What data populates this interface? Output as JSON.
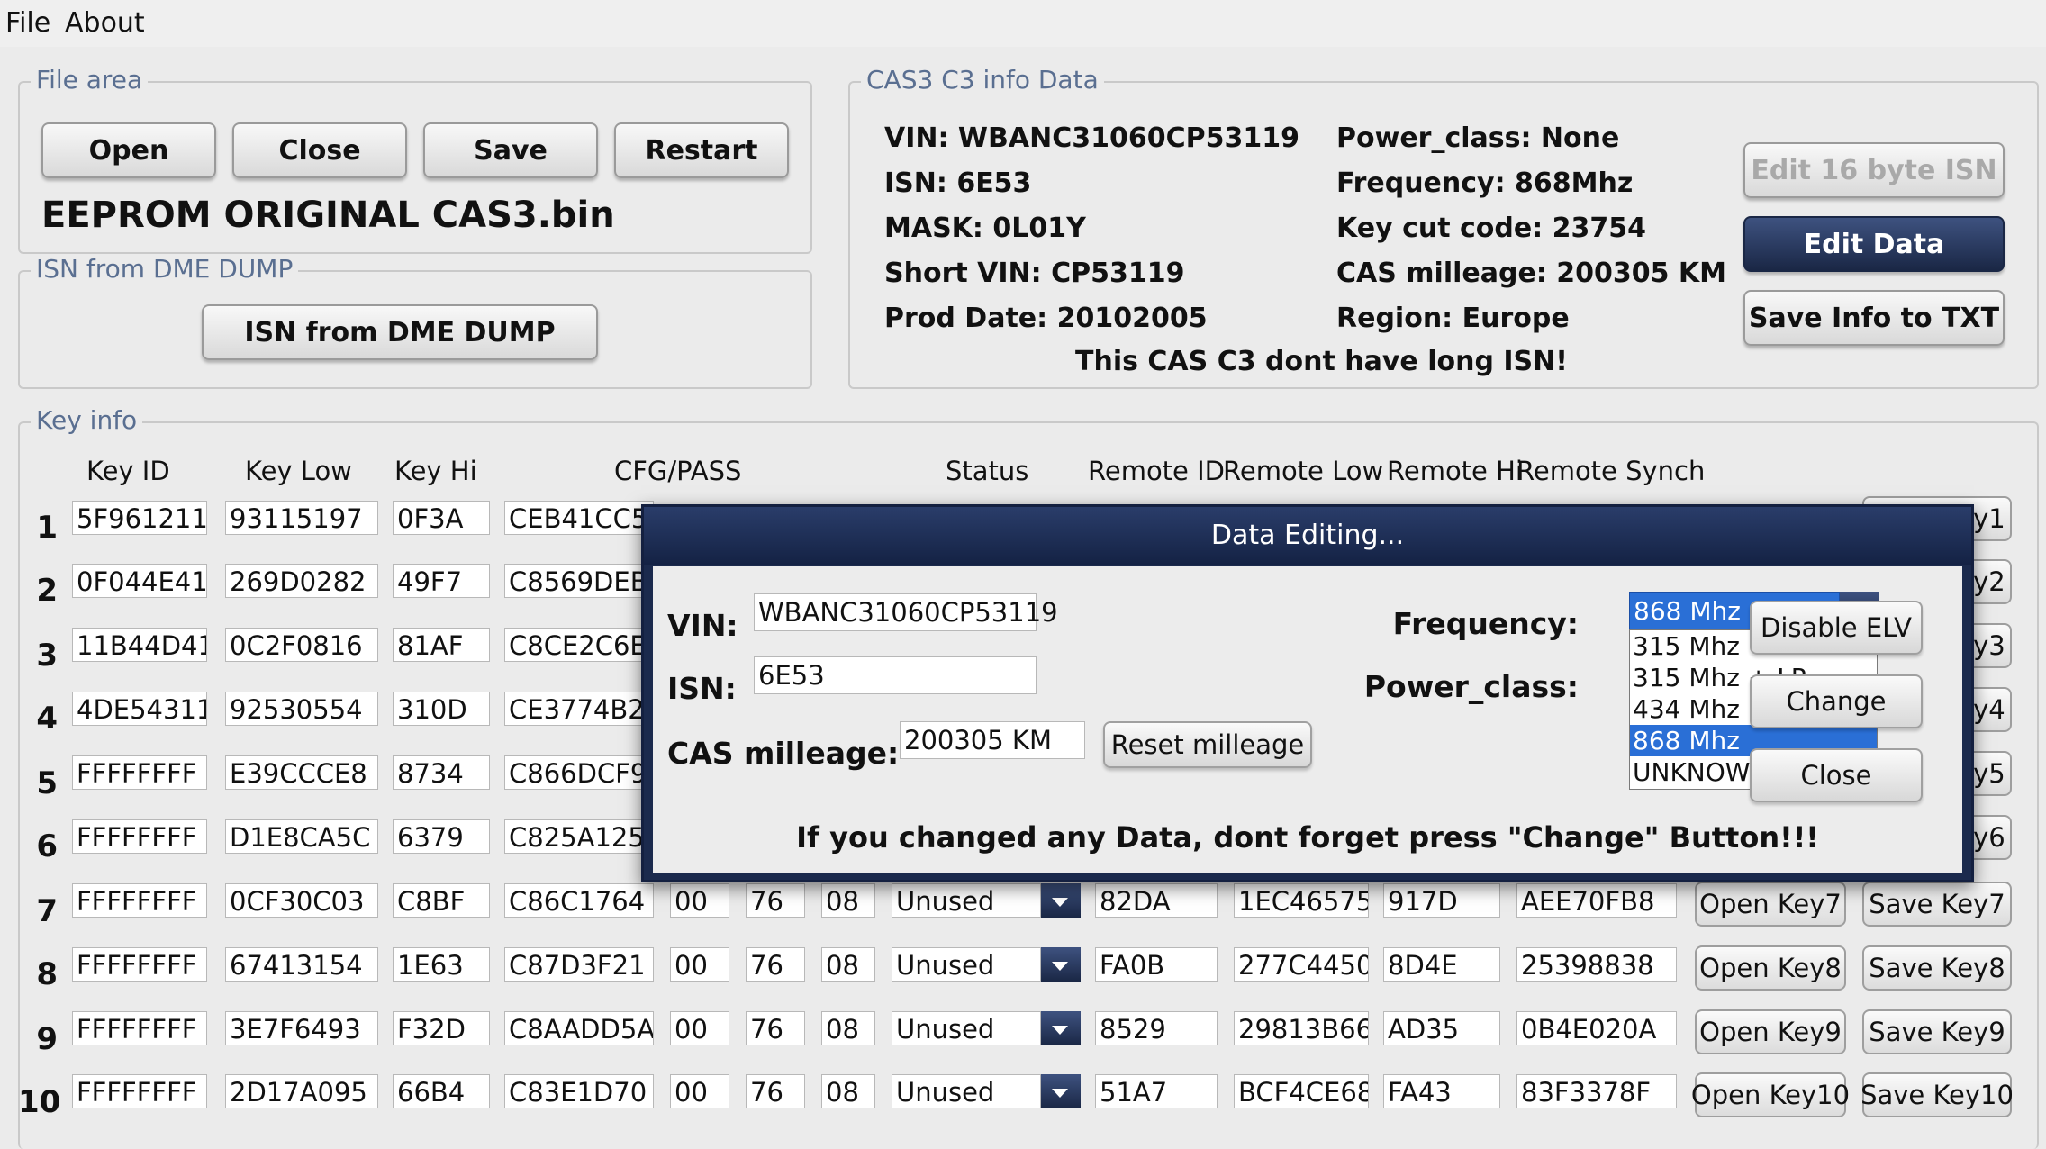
{
  "menu": {
    "file": "File",
    "about": "About"
  },
  "file_area": {
    "title": "File area",
    "open": "Open",
    "close": "Close",
    "save": "Save",
    "restart": "Restart",
    "filename": "EEPROM ORIGINAL CAS3.bin"
  },
  "isn_dme": {
    "title": "ISN from DME DUMP",
    "button": "ISN from DME DUMP"
  },
  "cas_info": {
    "title": "CAS3 C3 info Data",
    "vin": "VIN:  WBANC31060CP53119",
    "isn": "ISN:  6E53",
    "mask": "MASK:  0L01Y",
    "short_vin": "Short VIN:  CP53119",
    "prod_date": "Prod Date:  20102005",
    "power_class": "Power_class:  None",
    "frequency": "Frequency:  868Mhz",
    "key_cut": "Key cut code:  23754",
    "mileage": "CAS milleage:  200305 KM",
    "region": "Region:  Europe",
    "note": "This CAS C3 dont have long ISN!",
    "edit_isn": "Edit 16 byte ISN",
    "edit_data": "Edit Data",
    "save_txt": "Save Info to TXT"
  },
  "key_info": {
    "title": "Key info",
    "headers": {
      "key_id": "Key ID",
      "key_low": "Key Low",
      "key_hi": "Key Hi",
      "cfg": "CFG/PASS",
      "status": "Status",
      "remote_id": "Remote ID",
      "remote_low": "Remote Low",
      "remote_hi": "Remote Hi",
      "remote_synch": "Remote Synch"
    },
    "rows": [
      {
        "num": "1",
        "key_id": "5F961211",
        "key_low": "93115197",
        "key_hi": "0F3A",
        "cfg": "CEB41CC5",
        "save": "Save Key1"
      },
      {
        "num": "2",
        "key_id": "0F044E41",
        "key_low": "269D0282",
        "key_hi": "49F7",
        "cfg": "C8569DEB",
        "save": "Save Key2"
      },
      {
        "num": "3",
        "key_id": "11B44D41",
        "key_low": "0C2F0816",
        "key_hi": "81AF",
        "cfg": "C8CE2C6E",
        "save": "Save Key3"
      },
      {
        "num": "4",
        "key_id": "4DE54311",
        "key_low": "92530554",
        "key_hi": "310D",
        "cfg": "CE3774B2",
        "save": "Save Key4"
      },
      {
        "num": "5",
        "key_id": "FFFFFFFF",
        "key_low": "E39CCCE8",
        "key_hi": "8734",
        "cfg": "C866DCF9",
        "save": "Save Key5"
      },
      {
        "num": "6",
        "key_id": "FFFFFFFF",
        "key_low": "D1E8CA5C",
        "key_hi": "6379",
        "cfg": "C825A125",
        "save": "Save Key6"
      },
      {
        "num": "7",
        "key_id": "FFFFFFFF",
        "key_low": "0CF30C03",
        "key_hi": "C8BF",
        "cfg": "C86C1764",
        "p1": "00",
        "p2": "76",
        "p3": "08",
        "status": "Unused",
        "remote_id": "82DA",
        "remote_low": "1EC46575",
        "remote_hi": "917D",
        "remote_synch": "AEE70FB8",
        "open": "Open Key7",
        "save": "Save Key7"
      },
      {
        "num": "8",
        "key_id": "FFFFFFFF",
        "key_low": "67413154",
        "key_hi": "1E63",
        "cfg": "C87D3F21",
        "p1": "00",
        "p2": "76",
        "p3": "08",
        "status": "Unused",
        "remote_id": "FA0B",
        "remote_low": "277C4450",
        "remote_hi": "8D4E",
        "remote_synch": "25398838",
        "open": "Open Key8",
        "save": "Save Key8"
      },
      {
        "num": "9",
        "key_id": "FFFFFFFF",
        "key_low": "3E7F6493",
        "key_hi": "F32D",
        "cfg": "C8AADD5A",
        "p1": "00",
        "p2": "76",
        "p3": "08",
        "status": "Unused",
        "remote_id": "8529",
        "remote_low": "29813B66",
        "remote_hi": "AD35",
        "remote_synch": "0B4E020A",
        "open": "Open Key9",
        "save": "Save Key9"
      },
      {
        "num": "10",
        "key_id": "FFFFFFFF",
        "key_low": "2D17A095",
        "key_hi": "66B4",
        "cfg": "C83E1D70",
        "p1": "00",
        "p2": "76",
        "p3": "08",
        "status": "Unused",
        "remote_id": "51A7",
        "remote_low": "BCF4CE68",
        "remote_hi": "FA43",
        "remote_synch": "83F3378F",
        "open": "Open Key10",
        "save": "Save Key10"
      }
    ]
  },
  "dialog": {
    "title": "Data Editing...",
    "vin_label": "VIN:",
    "vin_value": "WBANC31060CP53119",
    "isn_label": "ISN:",
    "isn_value": "6E53",
    "mileage_label": "CAS milleage:",
    "mileage_value": "200305 KM",
    "reset_mileage": "Reset milleage",
    "frequency_label": "Frequency:",
    "power_class_label": "Power_class:",
    "frequency_selected": "868 Mhz",
    "frequency_options": [
      "315 Mhz",
      "315 Mhz + LP",
      "434 Mhz",
      "868 Mhz",
      "UNKNOWN"
    ],
    "disable_elv": "Disable ELV",
    "change": "Change",
    "close": "Close",
    "warning": "If you changed any Data, dont forget press \"Change\" Button!!!"
  },
  "colors": {
    "accent_dark": "#1a2745",
    "selection": "#2a6fd6",
    "group_title": "#5a6f91"
  }
}
